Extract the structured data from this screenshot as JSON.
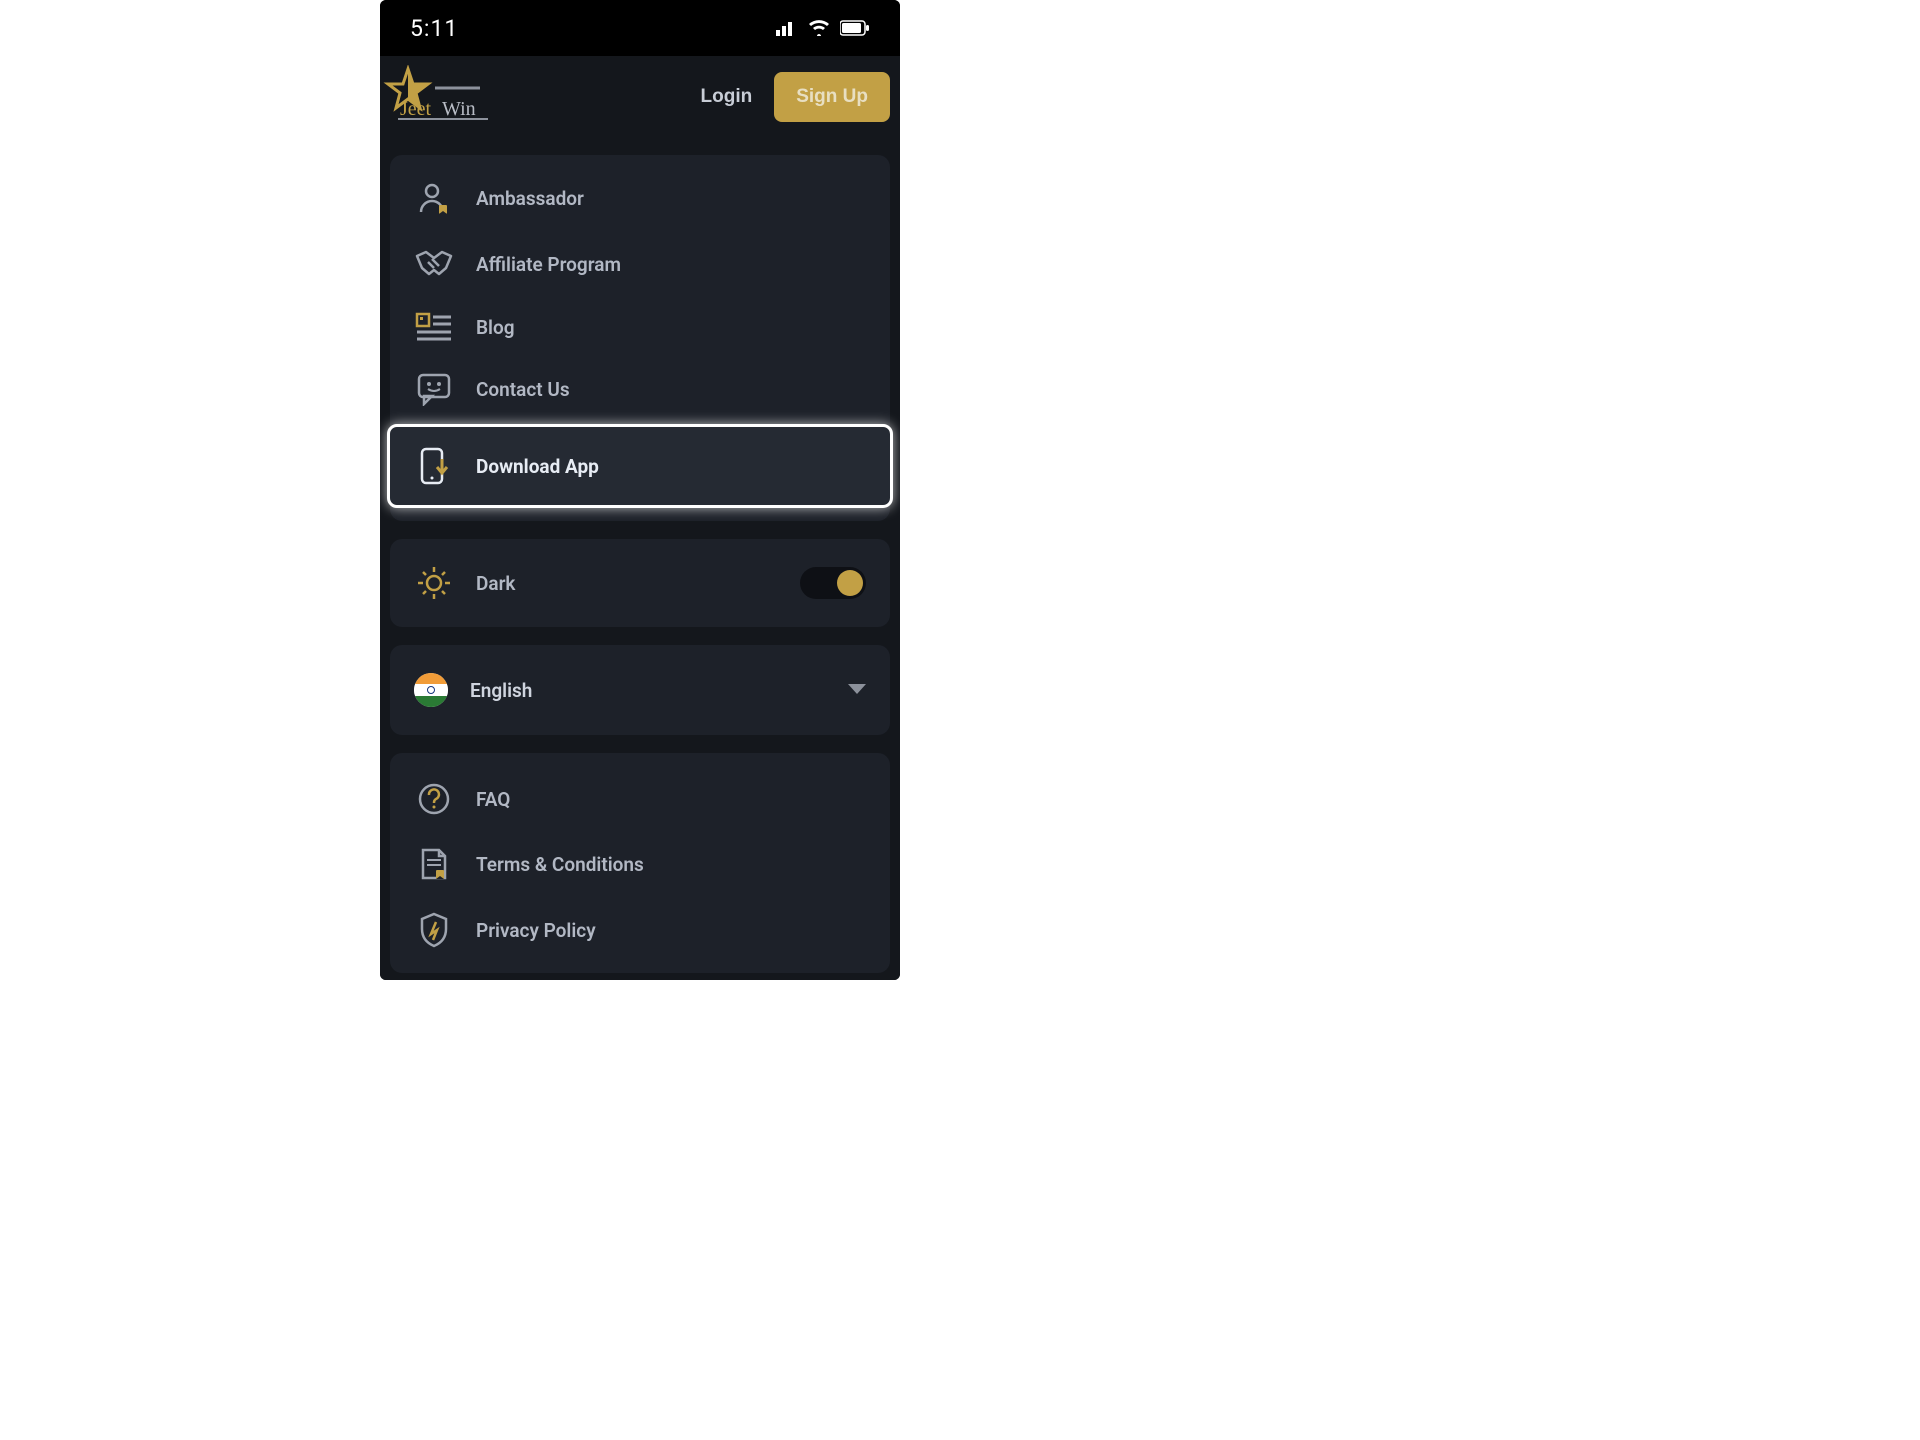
{
  "status": {
    "time": "5:11"
  },
  "header": {
    "login": "Login",
    "signup": "Sign Up",
    "brand": "JeetWin"
  },
  "menu1": {
    "items": [
      {
        "label": "Ambassador",
        "icon": "person-badge-icon"
      },
      {
        "label": "Affiliate Program",
        "icon": "handshake-icon"
      },
      {
        "label": "Blog",
        "icon": "blog-icon"
      },
      {
        "label": "Contact Us",
        "icon": "chat-icon"
      },
      {
        "label": "Download App",
        "icon": "download-app-icon",
        "highlighted": true
      }
    ]
  },
  "theme": {
    "label": "Dark",
    "enabled": true
  },
  "language": {
    "label": "English",
    "flag": "india"
  },
  "menu2": {
    "items": [
      {
        "label": "FAQ",
        "icon": "faq-icon"
      },
      {
        "label": "Terms & Conditions",
        "icon": "terms-icon"
      },
      {
        "label": "Privacy Policy",
        "icon": "shield-icon"
      }
    ]
  }
}
